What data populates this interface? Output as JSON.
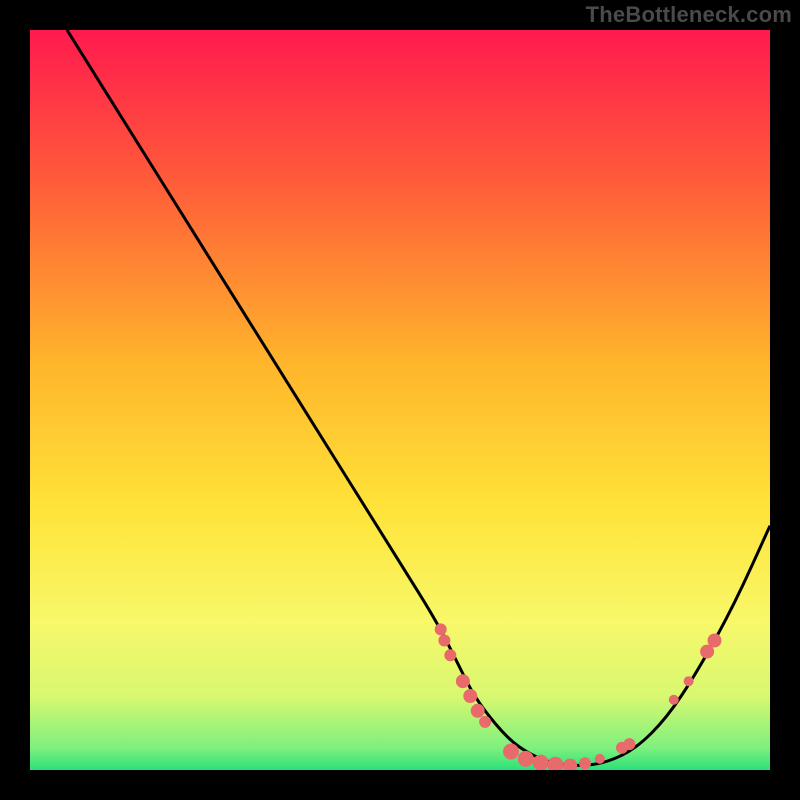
{
  "watermark": "TheBottleneck.com",
  "colors": {
    "background": "#000000",
    "watermark": "#4a4a4a",
    "curve": "#000000",
    "marker": "#e86a6a",
    "gradient_stops": [
      {
        "offset": 0.0,
        "color": "#ff1a4e"
      },
      {
        "offset": 0.2,
        "color": "#ff5a3a"
      },
      {
        "offset": 0.45,
        "color": "#ffb52b"
      },
      {
        "offset": 0.65,
        "color": "#ffe43a"
      },
      {
        "offset": 0.8,
        "color": "#f8f86a"
      },
      {
        "offset": 0.9,
        "color": "#d8f870"
      },
      {
        "offset": 0.97,
        "color": "#7ef07e"
      },
      {
        "offset": 1.0,
        "color": "#2de07a"
      }
    ]
  },
  "chart_data": {
    "type": "line",
    "title": "",
    "xlabel": "",
    "ylabel": "",
    "xlim": [
      0,
      100
    ],
    "ylim": [
      0,
      100
    ],
    "series": [
      {
        "name": "bottleneck-curve",
        "x": [
          5,
          10,
          15,
          20,
          25,
          30,
          35,
          40,
          45,
          50,
          55,
          58,
          60,
          63,
          66,
          70,
          74,
          78,
          82,
          86,
          90,
          95,
          100
        ],
        "y": [
          100,
          92,
          84,
          76,
          68,
          60,
          52,
          44,
          36,
          28,
          20,
          14,
          10,
          6,
          3,
          1,
          0.5,
          1,
          3,
          7,
          13,
          22,
          33
        ]
      }
    ],
    "markers": [
      {
        "x": 55.5,
        "y": 19.0,
        "r": 6
      },
      {
        "x": 56.0,
        "y": 17.5,
        "r": 6
      },
      {
        "x": 56.8,
        "y": 15.5,
        "r": 6
      },
      {
        "x": 58.5,
        "y": 12.0,
        "r": 7
      },
      {
        "x": 59.5,
        "y": 10.0,
        "r": 7
      },
      {
        "x": 60.5,
        "y": 8.0,
        "r": 7
      },
      {
        "x": 61.5,
        "y": 6.5,
        "r": 6
      },
      {
        "x": 65.0,
        "y": 2.5,
        "r": 8
      },
      {
        "x": 67.0,
        "y": 1.5,
        "r": 8
      },
      {
        "x": 69.0,
        "y": 1.0,
        "r": 8
      },
      {
        "x": 71.0,
        "y": 0.7,
        "r": 8
      },
      {
        "x": 73.0,
        "y": 0.6,
        "r": 7
      },
      {
        "x": 75.0,
        "y": 0.9,
        "r": 6
      },
      {
        "x": 77.0,
        "y": 1.5,
        "r": 5
      },
      {
        "x": 80.0,
        "y": 3.0,
        "r": 6
      },
      {
        "x": 81.0,
        "y": 3.5,
        "r": 6
      },
      {
        "x": 87.0,
        "y": 9.5,
        "r": 5
      },
      {
        "x": 89.0,
        "y": 12.0,
        "r": 5
      },
      {
        "x": 91.5,
        "y": 16.0,
        "r": 7
      },
      {
        "x": 92.5,
        "y": 17.5,
        "r": 7
      }
    ]
  }
}
